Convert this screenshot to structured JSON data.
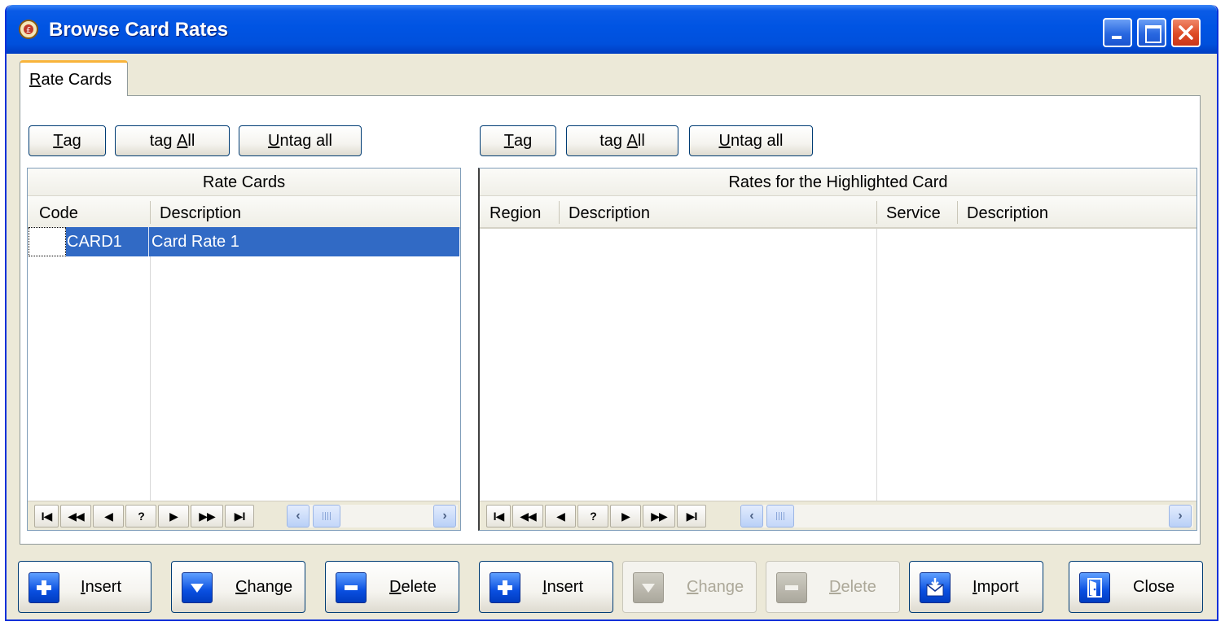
{
  "window": {
    "title": "Browse Card Rates",
    "colors": {
      "titlebar": "#0054E3",
      "selection": "#316AC5",
      "face": "#ECE9D8"
    }
  },
  "tabs": [
    {
      "label": "Rate Cards",
      "accel": "R",
      "rest": "ate Cards"
    }
  ],
  "left_panel": {
    "toolbar": {
      "tag": {
        "accel": "T",
        "rest": "ag"
      },
      "tag_all": {
        "pre": "tag ",
        "accel": "A",
        "rest": "ll"
      },
      "untag_all": {
        "accel": "U",
        "rest": "ntag all"
      }
    },
    "grid": {
      "caption": "Rate Cards",
      "columns": [
        "Code",
        "Description"
      ],
      "rows": [
        {
          "code": "CARD1",
          "description": "Card Rate 1"
        }
      ]
    },
    "nav": [
      "I◀",
      "◀◀",
      "◀",
      "?",
      "▶",
      "▶▶",
      "▶I"
    ]
  },
  "right_panel": {
    "toolbar": {
      "tag": {
        "accel": "T",
        "rest": "ag"
      },
      "tag_all": {
        "pre": "tag ",
        "accel": "A",
        "rest": "ll"
      },
      "untag_all": {
        "accel": "U",
        "rest": "ntag all"
      }
    },
    "grid": {
      "caption": "Rates for the Highlighted Card",
      "columns": [
        "Region",
        "Description",
        "Service",
        "Description"
      ],
      "rows": []
    },
    "nav": [
      "I◀",
      "◀◀",
      "◀",
      "?",
      "▶",
      "▶▶",
      "▶I"
    ]
  },
  "bottom_buttons": {
    "insert_left": {
      "accel": "I",
      "rest": "nsert",
      "icon": "plus-icon"
    },
    "change_left": {
      "accel": "C",
      "rest": "hange",
      "icon": "down-arrow-icon"
    },
    "delete_left": {
      "accel": "D",
      "rest": "elete",
      "icon": "minus-icon"
    },
    "insert_right": {
      "accel": "I",
      "rest": "nsert",
      "icon": "plus-icon"
    },
    "change_right": {
      "accel": "C",
      "rest": "hange",
      "icon": "down-arrow-icon",
      "enabled": false
    },
    "delete_right": {
      "accel": "D",
      "rest": "elete",
      "icon": "minus-icon",
      "enabled": false
    },
    "import": {
      "accel": "I",
      "rest": "mport",
      "icon": "import-envelope-icon"
    },
    "close": {
      "label": "Close",
      "icon": "door-exit-icon"
    }
  }
}
